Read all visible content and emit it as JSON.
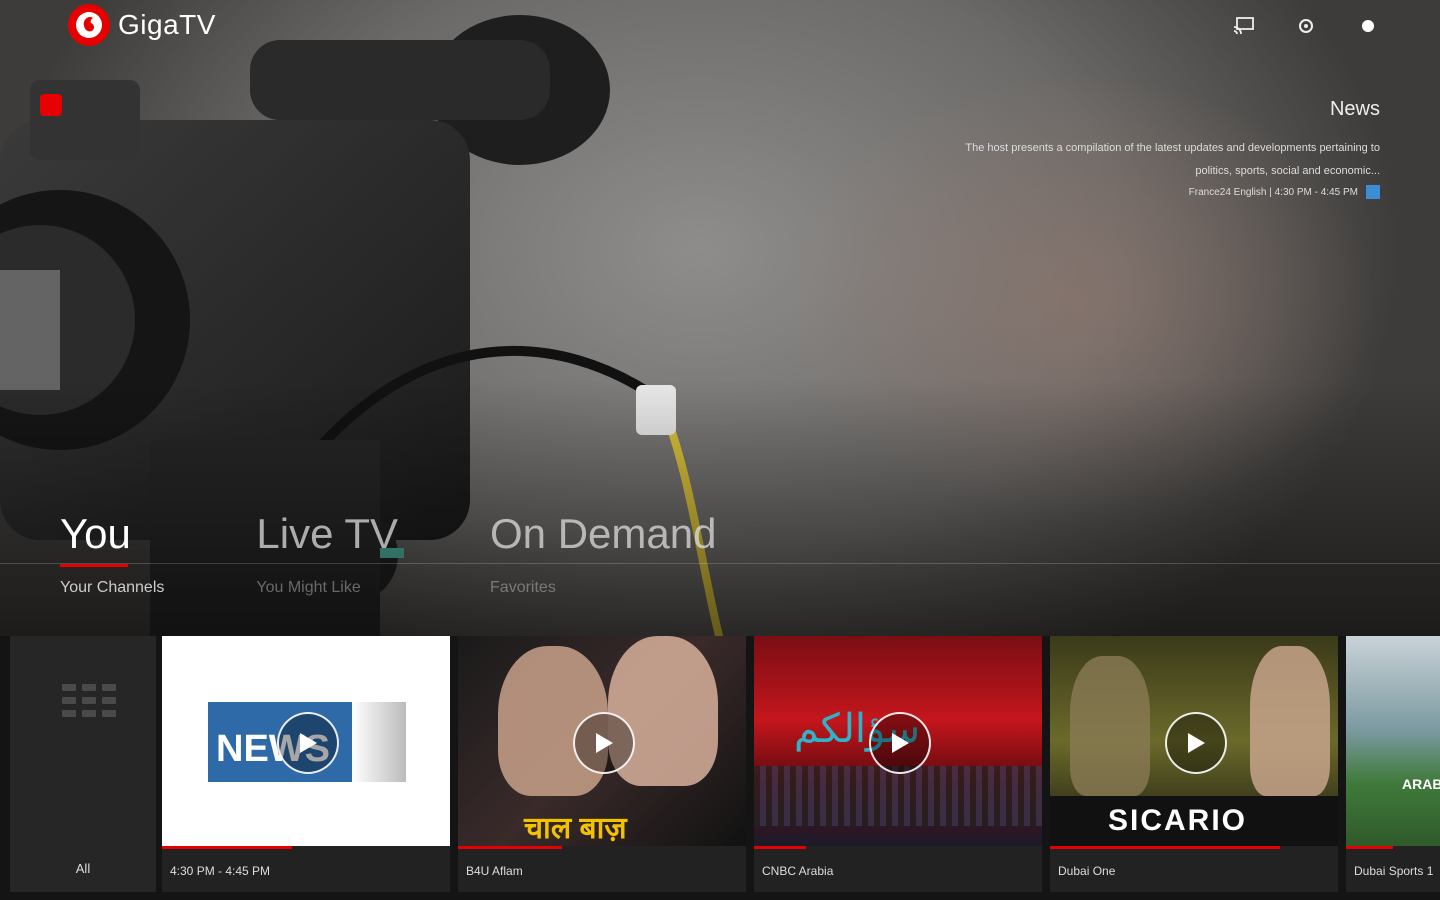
{
  "app": {
    "name": "GigaTV",
    "brand_color": "#e60000"
  },
  "header": {
    "icons": [
      "cast-icon",
      "settings-icon",
      "profile-icon"
    ]
  },
  "program": {
    "title": "News",
    "description": "The host presents a compilation of the latest updates and developments pertaining to politics, sports, social and economic...",
    "meta": "France24 English | 4:30 PM - 4:45 PM"
  },
  "tabs": [
    {
      "label": "You",
      "sub": "Your Channels",
      "active": true
    },
    {
      "label": "Live TV",
      "sub": "You Might Like",
      "active": false
    },
    {
      "label": "On Demand",
      "sub": "Favorites",
      "active": false
    }
  ],
  "rail": {
    "all_label": "All",
    "cards": [
      {
        "label": "4:30 PM - 4:45 PM",
        "thumb_text": "NEWS",
        "progress": 0.45
      },
      {
        "label": "B4U Aflam",
        "thumb_text": "चाल बाज़",
        "progress": 0.36
      },
      {
        "label": "CNBC Arabia",
        "thumb_text": "سؤالكم",
        "progress": 0.18
      },
      {
        "label": "Dubai One",
        "thumb_text": "SICARIO",
        "progress": 0.8
      },
      {
        "label": "Dubai Sports 1",
        "thumb_text": "ARAB",
        "progress": 0.5
      }
    ]
  }
}
